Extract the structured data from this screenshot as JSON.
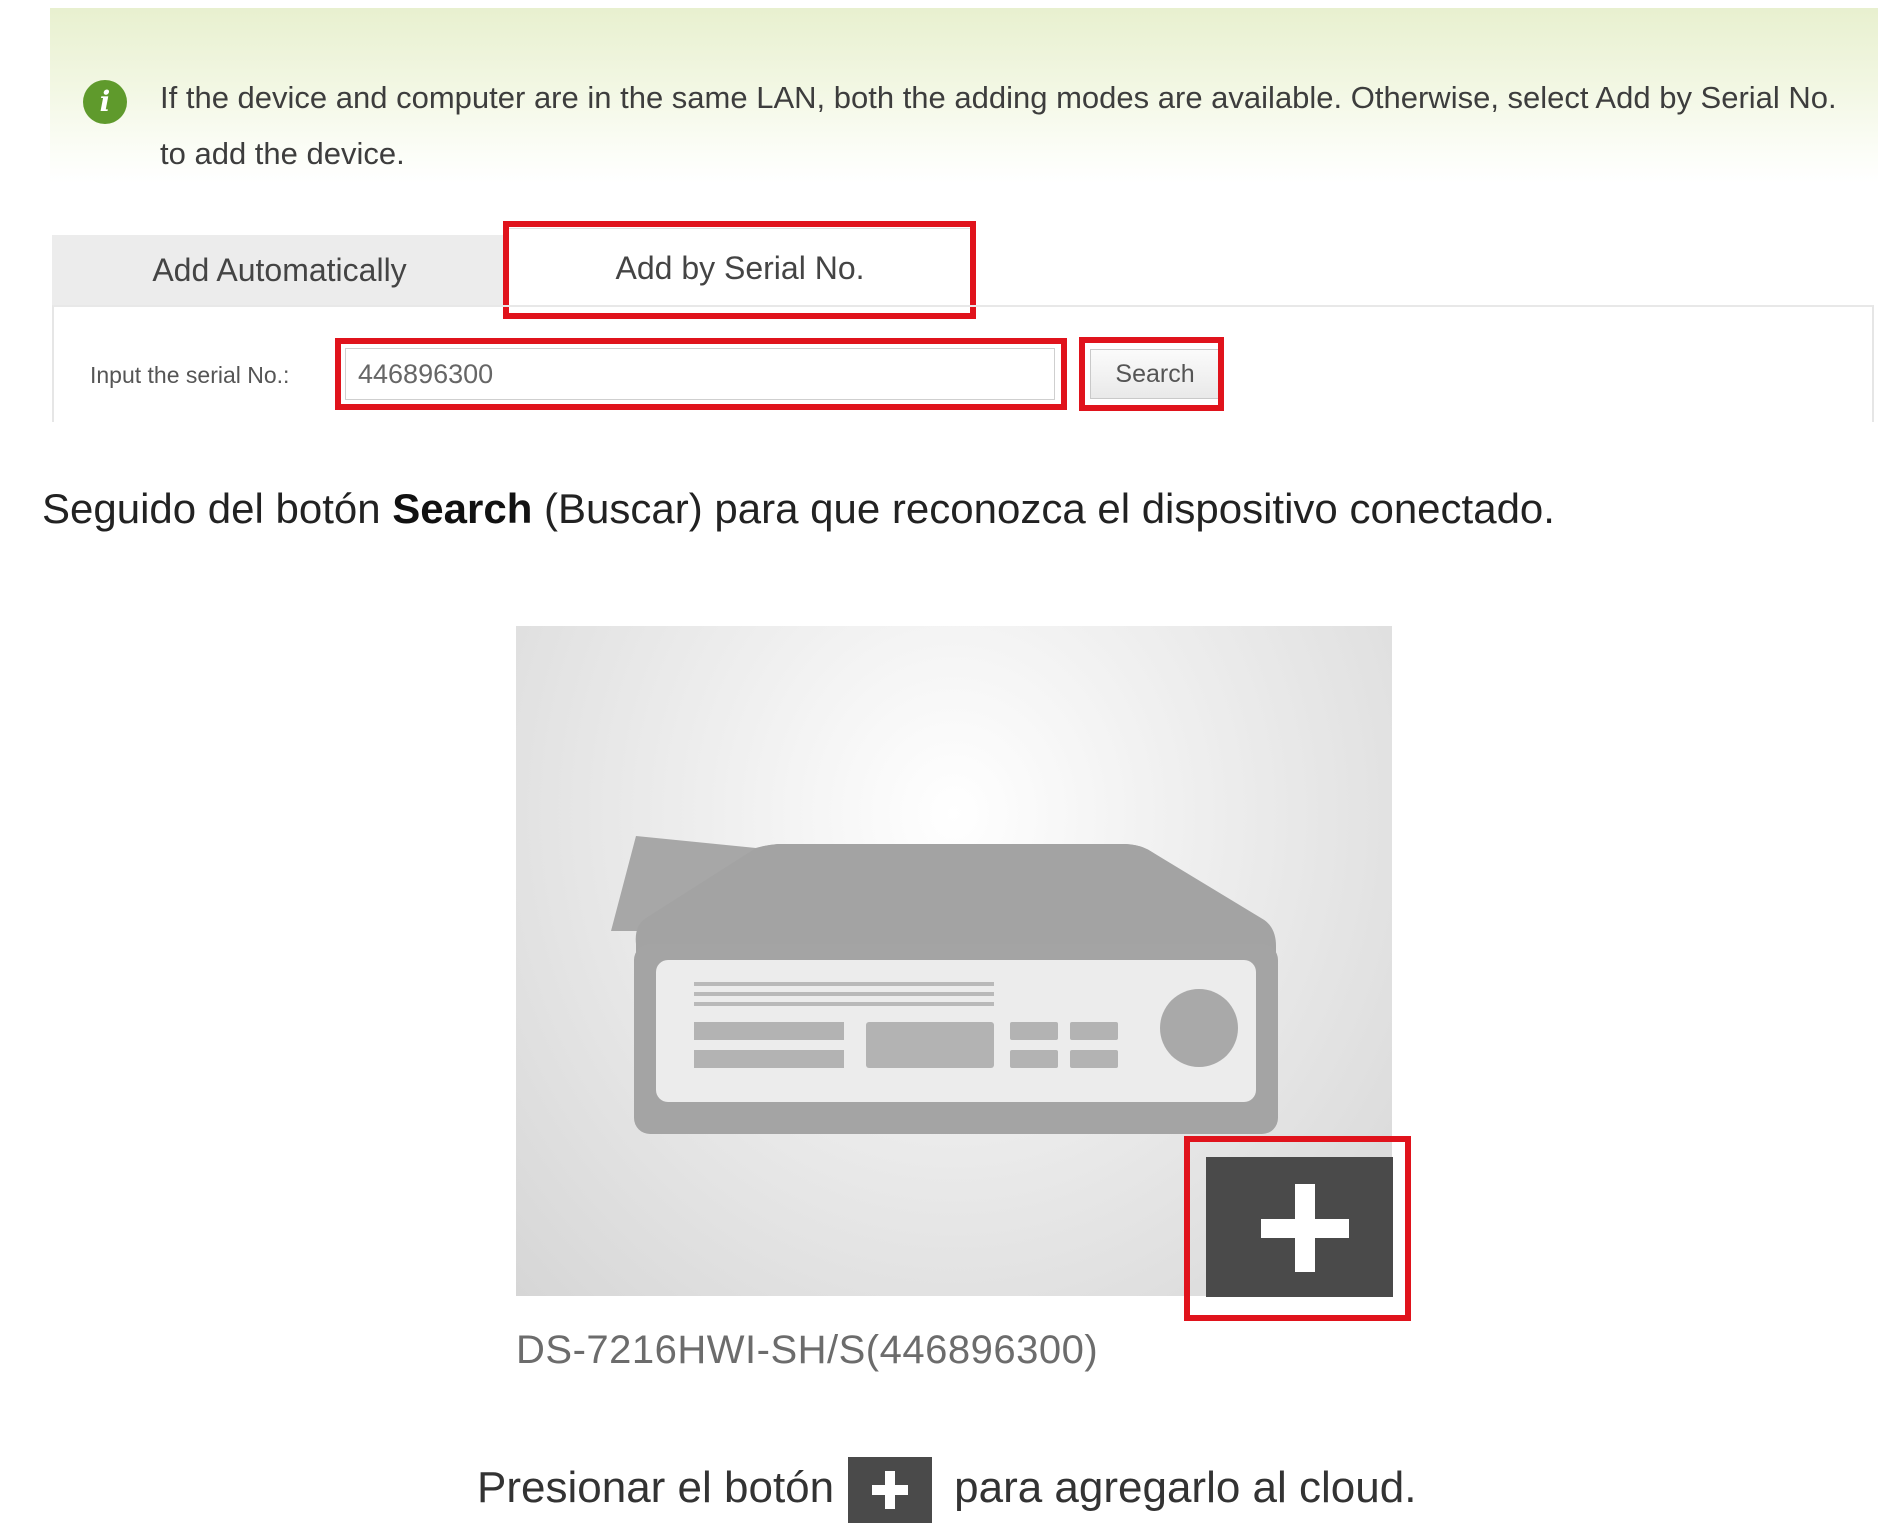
{
  "banner": {
    "icon": "info-icon",
    "icon_glyph": "i",
    "message": "If the device and computer are in the same LAN, both the adding modes are available. Otherwise, select Add by Serial No. to add the device."
  },
  "tabs": [
    {
      "label": "Add Automatically",
      "active": false
    },
    {
      "label": "Add by Serial No.",
      "active": true
    }
  ],
  "serial_form": {
    "label": "Input the serial No.:",
    "value": "446896300",
    "search_label": "Search"
  },
  "caption1": {
    "before": "Seguido del botón ",
    "bold": "Search",
    "after": " (Buscar) para que reconozca el dispositivo conectado."
  },
  "device": {
    "image": "dvr-device-icon",
    "name": "DS-7216HWI-SH/S(446896300)",
    "add_icon": "plus-icon"
  },
  "caption2": {
    "before": "Presionar  el botón",
    "icon": "plus-icon",
    "after": "para agregarlo al cloud."
  },
  "colors": {
    "highlight": "#e0131c",
    "info_green": "#5f9a2c",
    "button_dark": "#4a4a4a"
  }
}
